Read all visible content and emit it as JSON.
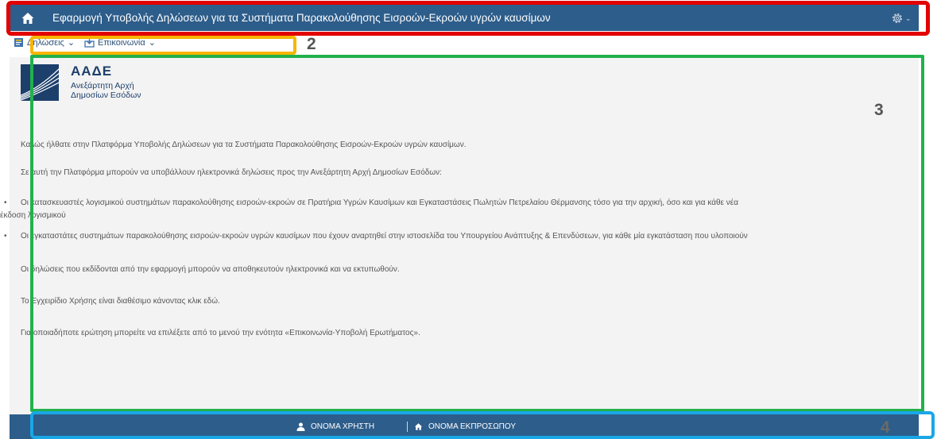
{
  "header": {
    "title": "Εφαρμογή Υποβολής Δηλώσεων για τα Συστήματα Παρακολούθησης Εισροών-Εκροών υγρών καυσίμων"
  },
  "menu": {
    "items": [
      {
        "label": "Δηλώσεις",
        "icon": "document-icon"
      },
      {
        "label": "Επικοινωνία",
        "icon": "inbox-icon"
      }
    ]
  },
  "logo": {
    "abbr": "ΑΑΔΕ",
    "name_line1": "Ανεξάρτητη Αρχή",
    "name_line2": "Δημοσίων Εσόδων"
  },
  "content": {
    "welcome": "Καλώς ήλθατε στην Πλατφόρμα Υποβολής Δηλώσεων για τα Συστήματα Παρακολούθησης Εισροών-Εκροών υγρών καυσίμων.",
    "intro": "Σε αυτή την Πλατφόρμα μπορούν να υποβάλλουν ηλεκτρονικά δηλώσεις προς την Ανεξάρτητη Αρχή Δημοσίων Εσόδων:",
    "bullets": [
      {
        "line1": "Οι κατασκευαστές λογισμικού συστημάτων παρακολούθησης εισροών-εκροών σε Πρατήρια Υγρών Καυσίμων και Εγκαταστάσεις Πωλητών Πετρελαίου Θέρμανσης τόσο για την αρχική, όσο και για κάθε νέα",
        "line2": "έκδοση λογισμικού"
      },
      {
        "line1": "Οι εγκαταστάτες συστημάτων παρακολούθησης εισροών-εκροών υγρών καυσίμων που έχουν αναρτηθεί στην ιστοσελίδα του Υπουργείου Ανάπτυξης & Επενδύσεων, για κάθε μία εγκατάσταση που υλοποιούν"
      }
    ],
    "save_print": "Οι δηλώσεις που εκδίδονται από την εφαρμογή μπορούν να αποθηκευτούν ηλεκτρονικά και να εκτυπωθούν.",
    "manual": "Το Εγχειρίδιο Χρήσης είναι διαθέσιμο κάνοντας κλικ εδώ.",
    "questions": "Για οποιαδήποτε ερώτηση μπορείτε να επιλέξετε από το μενού την ενότητα «Επικοινωνία-Υποβολή Ερωτήματος»."
  },
  "footer": {
    "username": "ΟΝΟΜΑ ΧΡΗΣΤΗ",
    "representative": "ΟΝΟΜΑ ΕΚΠΡΟΣΩΠΟΥ"
  },
  "annotations": {
    "labels": [
      "2",
      "3",
      "4"
    ],
    "colors": [
      "#e20000",
      "#f7b500",
      "#22b14c",
      "#19a7e6"
    ]
  }
}
